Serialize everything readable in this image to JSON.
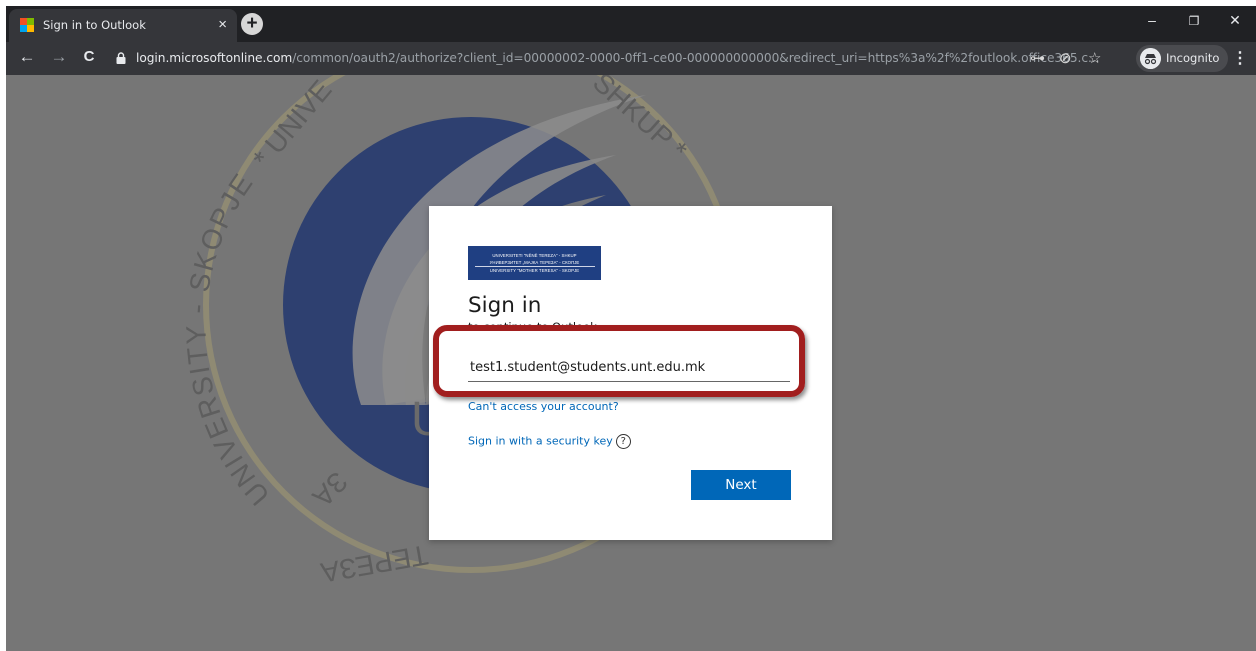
{
  "tab": {
    "title": "Sign in to Outlook",
    "close_glyph": "×",
    "new_tab_glyph": "+"
  },
  "window_controls": {
    "minimize": "–",
    "restore": "❐",
    "close": "✕"
  },
  "nav": {
    "back": "←",
    "forward": "→",
    "reload": "C"
  },
  "address": {
    "host": "login.microsoftonline.com",
    "path": "/common/oauth2/authorize?client_id=00000002-0000-0ff1-ce00-000000000000&redirect_uri=https%3a%2f%2foutlook.office365.c..."
  },
  "omnibox_icons": {
    "key": "⊶",
    "eye_off": "⊘",
    "star": "☆"
  },
  "profile": {
    "label": "Incognito"
  },
  "menu_glyph": "⋮",
  "background_seal": {
    "left_text": "UNIVERSITY - SKOPJE",
    "top_left_text": "* UNIVE",
    "top_right_text": "SHKUP *",
    "bottom_text": "ТЕРЕЗА",
    "bottom_left_text": "ЗА",
    "center_letter": "U",
    "colors": {
      "navy": "#2e4070",
      "gold": "#8f8a73"
    }
  },
  "signin": {
    "logo_lines": [
      "UNIVERSITETI \"NËNË TEREZA\" - SHKUP",
      "УНИВЕРЗИТЕТ „МАЈКА ТЕРЕЗА\" - СКОПЈЕ",
      "UNIVERSITY \"MOTHER TERESA\" - SKOPJE"
    ],
    "heading": "Sign in",
    "subheading": "to continue to Outlook",
    "email_value": "test1.student@students.unt.edu.mk",
    "cant_access": "Can't access your account?",
    "security_key": "Sign in with a security key",
    "help_glyph": "?",
    "next": "Next"
  },
  "colors": {
    "link": "#0067b8",
    "button": "#0067b8",
    "highlight": "#a11e1e",
    "backdrop": "#767676"
  }
}
